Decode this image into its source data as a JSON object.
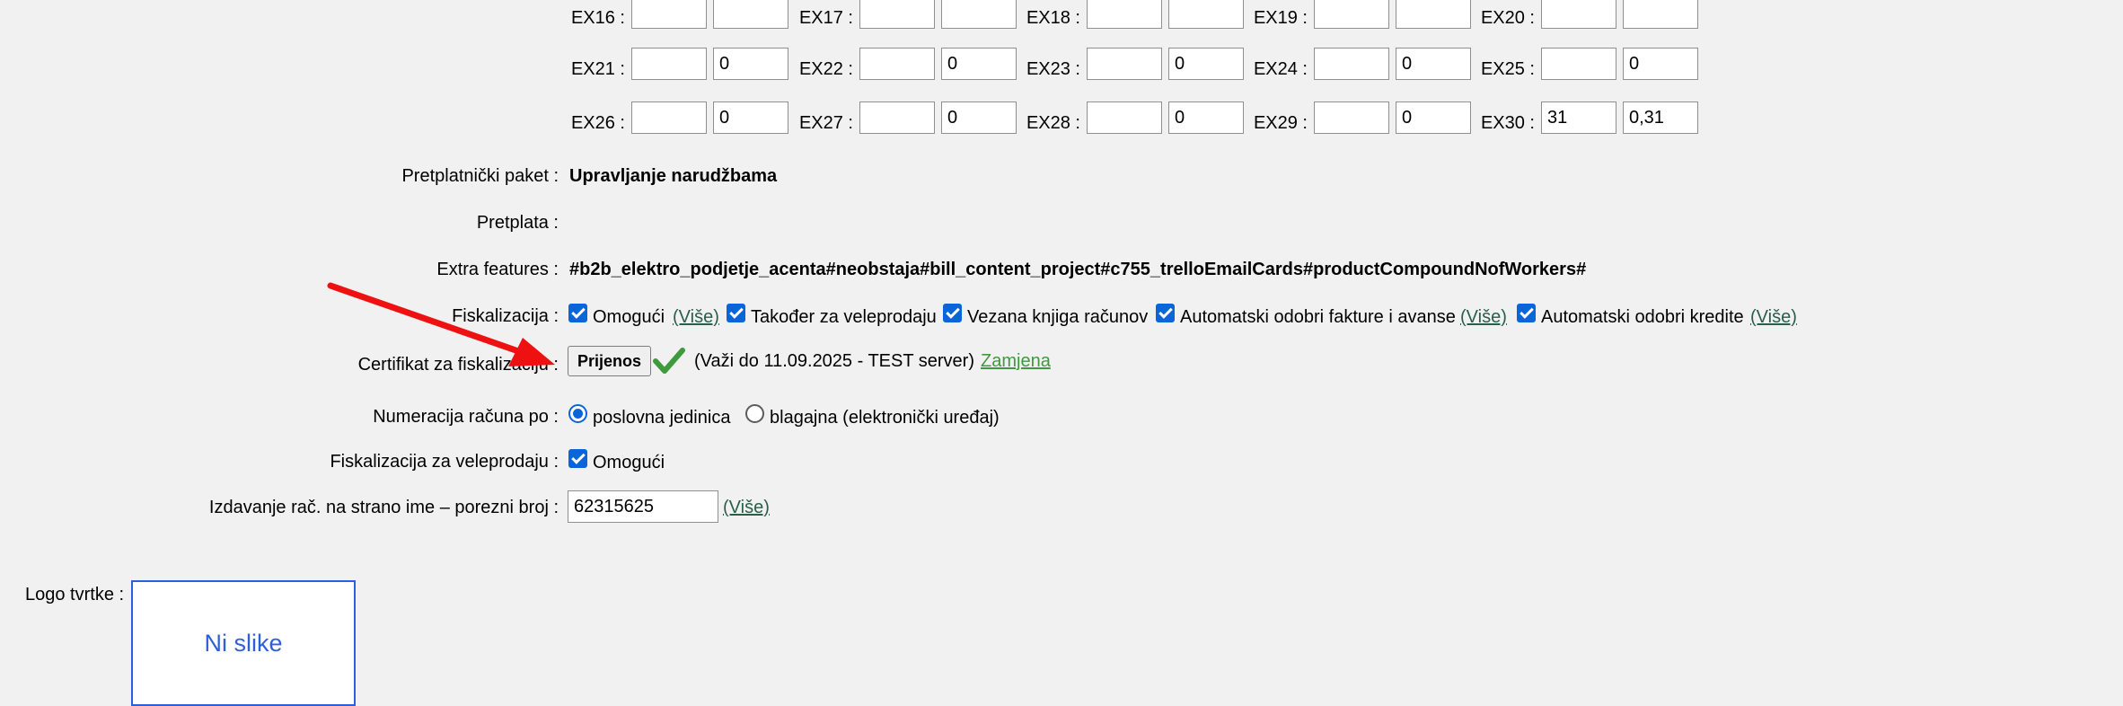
{
  "ex_rows": [
    [
      {
        "label": "EX16 :",
        "v1": "",
        "v2": ""
      },
      {
        "label": "EX17 :",
        "v1": "",
        "v2": ""
      },
      {
        "label": "EX18 :",
        "v1": "",
        "v2": ""
      },
      {
        "label": "EX19 :",
        "v1": "",
        "v2": ""
      },
      {
        "label": "EX20 :",
        "v1": "",
        "v2": ""
      }
    ],
    [
      {
        "label": "EX21 :",
        "v1": "",
        "v2": "0"
      },
      {
        "label": "EX22 :",
        "v1": "",
        "v2": "0"
      },
      {
        "label": "EX23 :",
        "v1": "",
        "v2": "0"
      },
      {
        "label": "EX24 :",
        "v1": "",
        "v2": "0"
      },
      {
        "label": "EX25 :",
        "v1": "",
        "v2": "0"
      }
    ],
    [
      {
        "label": "EX26 :",
        "v1": "",
        "v2": "0"
      },
      {
        "label": "EX27 :",
        "v1": "",
        "v2": "0"
      },
      {
        "label": "EX28 :",
        "v1": "",
        "v2": "0"
      },
      {
        "label": "EX29 :",
        "v1": "",
        "v2": "0"
      },
      {
        "label": "EX30 :",
        "v1": "31",
        "v2": "0,31"
      }
    ]
  ],
  "package": {
    "label": "Pretplatnički paket :",
    "value": "Upravljanje narudžbama"
  },
  "subscription": {
    "label": "Pretplata :"
  },
  "extra": {
    "label": "Extra features :",
    "value": "#b2b_elektro_podjetje_acenta#neobstaja#bill_content_project#c755_trelloEmailCards#productCompoundNofWorkers#"
  },
  "fiscal": {
    "label": "Fiskalizacija :",
    "enable": "Omogući",
    "more1": "(Više)",
    "wholesale": "Također za veleprodaju",
    "bound_book": "Vezana knjiga računov",
    "auto_approve": "Automatski odobri fakture i avanse",
    "more2": "(Više)",
    "auto_credit": "Automatski odobri kredite",
    "more3": "(Više)"
  },
  "certificate": {
    "label": "Certifikat za fiskalizaciju :",
    "upload_button": "Prijenos",
    "validity": "(Važi do 11.09.2025 - TEST server)",
    "replace_link": "Zamjena"
  },
  "numbering": {
    "label": "Numeracija računa po :",
    "option1": "poslovna jedinica",
    "option2": "blagajna (elektronički uređaj)"
  },
  "wholesale_fiscal": {
    "label": "Fiskalizacija za veleprodaju :",
    "enable": "Omogući"
  },
  "foreign": {
    "label": "Izdavanje rač. na strano ime – porezni broj :",
    "value": "62315625",
    "more": "(Više)"
  },
  "logo": {
    "label": "Logo tvrtke :",
    "placeholder": "Ni slike"
  },
  "colors": {
    "accent": "#0a66d8",
    "arrow": "#ee1111",
    "link": "#2a5d4a",
    "check": "#3d9a3d"
  }
}
